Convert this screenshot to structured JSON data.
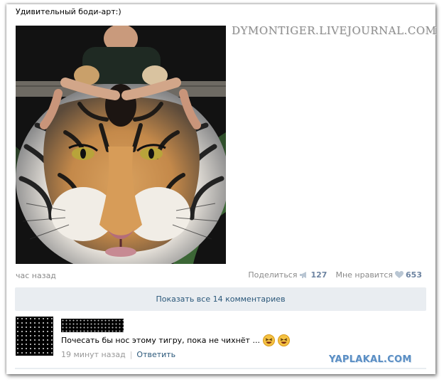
{
  "post": {
    "text": "Удивительный боди-арт:)",
    "time": "час назад",
    "share_label": "Поделиться",
    "share_count": "127",
    "like_label": "Мне нравится",
    "like_count": "653",
    "share_icon": "megaphone-icon",
    "like_icon": "heart-icon"
  },
  "comments_toggle": {
    "label": "Показать все 14 комментариев"
  },
  "comment": {
    "text": "Почесать бы нос этому тигру, пока не чихнёт ...",
    "time": "19 минут назад",
    "separator": "|",
    "reply_label": "Ответить",
    "emojis": [
      "laughing-emoji",
      "laughing-emoji"
    ]
  },
  "watermarks": {
    "top": "DYMONTIGER.LIVEJOURNAL.COM",
    "bottom": "YAPLAKAL.COM"
  },
  "colors": {
    "link": "#2b587a",
    "count": "#6d84a1",
    "panel": "#e9edf1",
    "muted": "#8a8a8a"
  }
}
